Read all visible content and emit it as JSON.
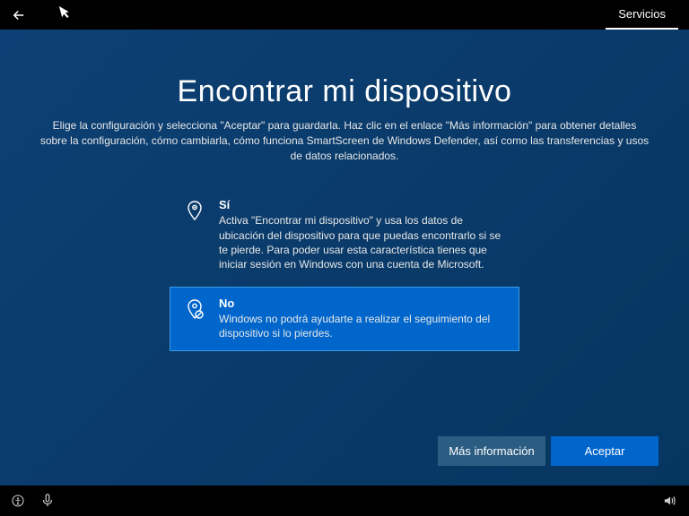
{
  "titlebar": {
    "tab": "Servicios"
  },
  "page": {
    "title": "Encontrar mi dispositivo",
    "subtitle": "Elige la configuración y selecciona \"Aceptar\" para guardarla. Haz clic en el enlace \"Más información\" para obtener detalles sobre la configuración, cómo cambiarla, cómo funciona SmartScreen de Windows Defender, así como las transferencias y usos de datos relacionados."
  },
  "options": {
    "yes": {
      "title": "Sí",
      "desc": "Activa \"Encontrar mi dispositivo\" y usa los datos de ubicación del dispositivo para que puedas encontrarlo si se te pierde. Para poder usar esta característica tienes que iniciar sesión en Windows con una cuenta de Microsoft."
    },
    "no": {
      "title": "No",
      "desc": "Windows no podrá ayudarte a realizar el seguimiento del dispositivo si lo pierdes."
    }
  },
  "buttons": {
    "more_info": "Más información",
    "accept": "Aceptar"
  }
}
